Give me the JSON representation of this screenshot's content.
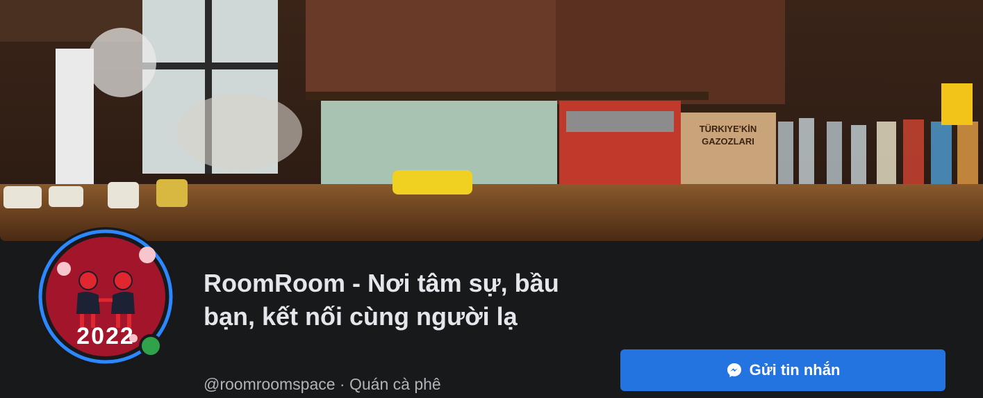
{
  "page": {
    "name": "RoomRoom - Nơi tâm sự, bầu bạn, kết nối cùng người lạ",
    "handle": "@roomroomspace",
    "separator": " · ",
    "category": "Quán cà phê"
  },
  "avatar": {
    "year_text": "2022",
    "online": true
  },
  "actions": {
    "message_label": "Gửi tin nhắn",
    "message_icon": "messenger-icon"
  },
  "cover": {
    "box_text_line1": "TÜRKIYE'KİN",
    "box_text_line2": "GAZOZLARI"
  },
  "colors": {
    "background": "#18191a",
    "primary_button": "#2374e1",
    "online": "#31a24c",
    "avatar_ring": "#2d88ff",
    "avatar_bg": "#a3152a"
  }
}
